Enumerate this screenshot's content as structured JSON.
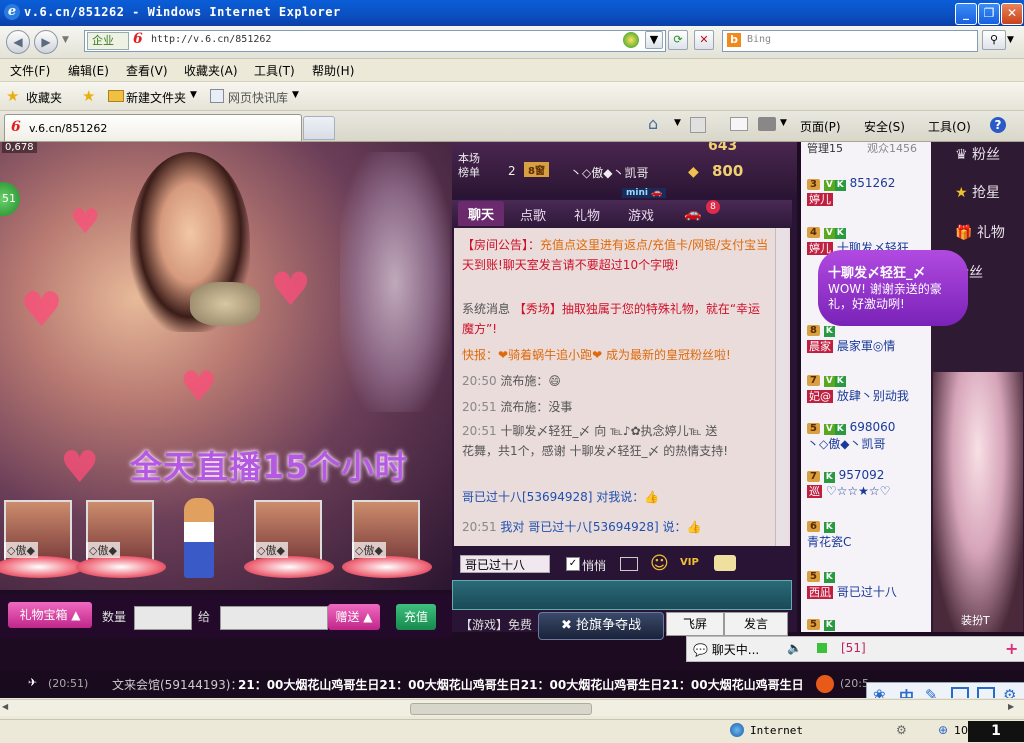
{
  "window": {
    "title": "v.6.cn/851262 - Windows Internet Explorer",
    "buttons": {
      "minimize": "_",
      "maximize": "❐",
      "close": "✕"
    }
  },
  "address": {
    "zone": "企业",
    "url": "http://v.6.cn/851262",
    "search_placeholder": "Bing"
  },
  "menu": [
    "文件(F)",
    "编辑(E)",
    "查看(V)",
    "收藏夹(A)",
    "工具(T)",
    "帮助(H)"
  ],
  "favorites": {
    "favorites_label": "收藏夹",
    "new_folder": "新建文件夹",
    "web_slice": "网页快讯库"
  },
  "tab": {
    "label": "v.6.cn/851262"
  },
  "commands": {
    "page": "页面(P)",
    "safety": "安全(S)",
    "tools": "工具(O)"
  },
  "video": {
    "viewer_count": "0,678",
    "badge": "51",
    "banner": "全天直播15个小时",
    "stage_caption": "◇傲◆"
  },
  "giftbar": {
    "gift_box": "礼物宝箱",
    "qty_label": "数量",
    "to_label": "给",
    "send": "赠送",
    "recharge": "充值"
  },
  "rank": {
    "label1": "本场",
    "label2": "榜单",
    "rank_no": "2",
    "name": "丶◇傲◆丶凯哥",
    "score": "800",
    "score_top": "643"
  },
  "chat_tabs": [
    "聊天",
    "点歌",
    "礼物",
    "游戏"
  ],
  "chat_count": "8",
  "chat_lines": [
    {
      "prefix": "【房间公告】：",
      "text": "充值点这里进有返点/充值卡/网银/支付宝当"
    },
    {
      "prefix": "",
      "text": "天到账!聊天室发言请不要超过10个字哦!"
    },
    {
      "prefix": "系统消息 ",
      "text": "【秀场】抽取独属于您的特殊礼物，就在“幸运"
    },
    {
      "prefix": "",
      "text": "魔方”!"
    },
    {
      "prefix": "快报：",
      "text": "❤骑着蜗牛追小跑❤ 成为最新的皇冠粉丝啦!"
    },
    {
      "prefix": "20:50 ",
      "text": "流布施：😄"
    },
    {
      "prefix": "20:51 ",
      "text": "流布施：没事"
    },
    {
      "prefix": "20:51 ",
      "text": "十聊发〆轻狂_〆 向 ℡♪✿执念婷儿℡ 送"
    },
    {
      "prefix": "",
      "text": "花舞，共1个，感谢 十聊发〆轻狂_〆 的热情支持!"
    },
    {
      "prefix": "",
      "text": "哥已过十八[53694928] 对我说：👍"
    },
    {
      "prefix": "20:51 ",
      "text": "我对 哥已过十八[53694928] 说：👍"
    }
  ],
  "chat_input": {
    "recipient": "哥已过十八",
    "private_label": "悄悄",
    "game_label": "【游戏】免费",
    "grab_flag": "抢旗争夺战",
    "fly_screen": "飞屏",
    "send": "发言"
  },
  "userlist": {
    "tabs": [
      "管理15",
      "观众1456"
    ],
    "users": [
      {
        "level": "3",
        "name": "851262",
        "tag": "婷儿"
      },
      {
        "level": "4",
        "name": "十聊发〆轻狂",
        "tag": "婷儿"
      },
      {
        "level": "8",
        "name": "晨家軍◎情",
        "tag": "晨家"
      },
      {
        "level": "7",
        "name": "放肆丶别动我",
        "tag": "妃@"
      },
      {
        "level": "5",
        "name": "698060",
        "tag": "丶◇傲◆丶凯哥"
      },
      {
        "level": "7",
        "name": "957092",
        "tag": "巡"
      },
      {
        "level": "",
        "name": "♡☆☆★☆♡",
        "tag": ""
      },
      {
        "level": "6",
        "name": "青花瓷C",
        "tag": ""
      },
      {
        "level": "5",
        "name": "哥已过十八",
        "tag": "西凪"
      },
      {
        "level": "5",
        "name": "",
        "tag": ""
      }
    ]
  },
  "bubble": {
    "title": "十聊发〆轻狂_〆",
    "text": "WOW! 谢谢亲送的豪礼，好激动咧!"
  },
  "rightpanel": [
    "粉丝",
    "抢星",
    "礼物",
    "粉丝"
  ],
  "dressup": "装扮T",
  "online": {
    "chat_label": "聊天中...",
    "count": "[51]"
  },
  "ticker": {
    "time1": "(20:51)",
    "sender": "文来会馆(59144193)：",
    "message": "21：00大烟花山鸡哥生日21：00大烟花山鸡哥生日21：00大烟花山鸡哥生日21：00大烟花山鸡哥生日",
    "time2": "(20:5"
  },
  "ime": [
    "中"
  ],
  "status": {
    "zone": "Internet",
    "zoom": "10"
  },
  "taskbar": {
    "num": "1"
  }
}
